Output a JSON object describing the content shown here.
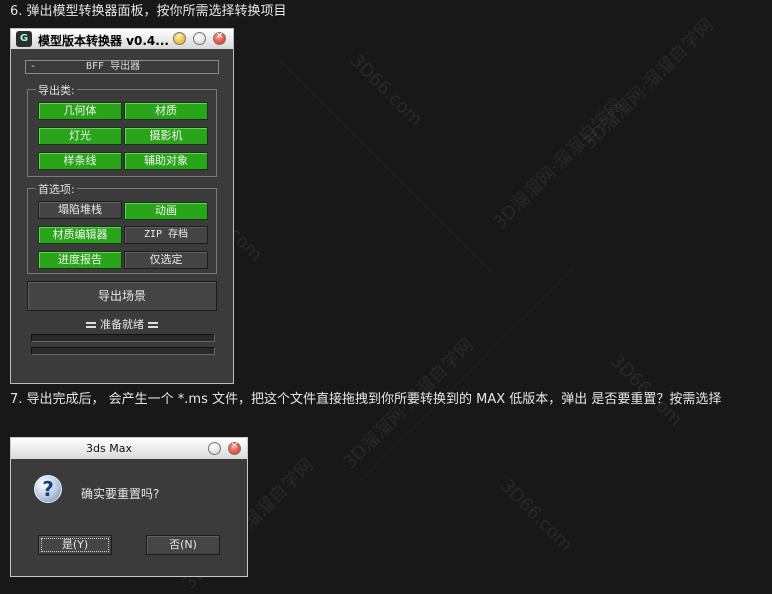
{
  "steps": {
    "step6": "6. 弹出模型转换器面板，按你所需选择转换项目",
    "step7": "7. 导出完成后，  会产生一个  *.ms 文件，把这个文件直接拖拽到你所要转换到的  MAX 低版本，弹出  是否要重置？按需选择"
  },
  "watermark": {
    "domain": "3D66.com",
    "site": "3D溜溜网·溜溜自学网"
  },
  "converter": {
    "title": "模型版本转换器 v0.4...",
    "app_icon": "G",
    "rollout": {
      "collapse_glyph": "-",
      "title": "BFF 导出器"
    },
    "export_group": {
      "label": "导出类:",
      "buttons": [
        {
          "label": "几何体",
          "on": true
        },
        {
          "label": "材质",
          "on": true
        },
        {
          "label": "灯光",
          "on": true
        },
        {
          "label": "摄影机",
          "on": true
        },
        {
          "label": "样条线",
          "on": true
        },
        {
          "label": "辅助对象",
          "on": true
        }
      ]
    },
    "prefs_group": {
      "label": "首选项:",
      "buttons": [
        {
          "label": "塌陷堆栈",
          "on": false
        },
        {
          "label": "动画",
          "on": true
        },
        {
          "label": "材质编辑器",
          "on": true
        },
        {
          "label": "ZIP 存档",
          "on": false
        },
        {
          "label": "进度报告",
          "on": true
        },
        {
          "label": "仅选定",
          "on": false
        }
      ]
    },
    "export_scene": "导出场景",
    "status": "准备就绪",
    "progress": [
      0,
      0
    ]
  },
  "dialog": {
    "title": "3ds Max",
    "icon": "?",
    "message": "确实要重置吗?",
    "yes": "是(Y)",
    "no": "否(N)"
  },
  "colors": {
    "active_green": "#2aa41b",
    "panel_gray": "#3b3b3b",
    "background": "#181818"
  },
  "icons": [
    "question-icon",
    "minimize-icon",
    "maximize-icon",
    "close-icon"
  ]
}
